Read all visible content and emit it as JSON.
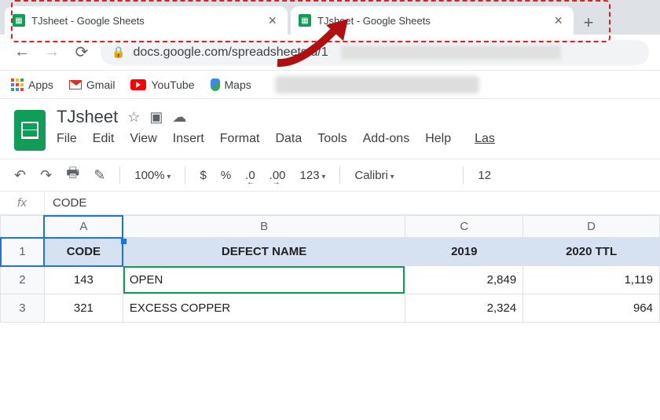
{
  "browser": {
    "tabs": [
      {
        "title": "TJsheet - Google Sheets"
      },
      {
        "title": "TJsheet - Google Sheets"
      }
    ],
    "url": "docs.google.com/spreadsheets/d/1"
  },
  "bookmarks": {
    "apps": "Apps",
    "gmail": "Gmail",
    "youtube": "YouTube",
    "maps": "Maps"
  },
  "doc": {
    "title": "TJsheet",
    "menus": [
      "File",
      "Edit",
      "View",
      "Insert",
      "Format",
      "Data",
      "Tools",
      "Add-ons",
      "Help"
    ],
    "last_edit": "Las"
  },
  "toolbar": {
    "zoom": "100%",
    "currency": "$",
    "percent": "%",
    "dec_dec": ".0",
    "dec_inc": ".00",
    "numfmt": "123",
    "font": "Calibri",
    "fontsize": "12"
  },
  "formula_bar": {
    "label": "fx",
    "value": "CODE"
  },
  "sheet": {
    "columns": [
      "A",
      "B",
      "C",
      "D"
    ],
    "row_labels": [
      "1",
      "2",
      "3"
    ],
    "header": [
      "CODE",
      "DEFECT NAME",
      "2019",
      "2020 TTL"
    ],
    "rows": [
      {
        "code": "143",
        "name": "OPEN",
        "y2019": "2,849",
        "y2020": "1,119"
      },
      {
        "code": "321",
        "name": "EXCESS COPPER",
        "y2019": "2,324",
        "y2020": "964"
      }
    ]
  }
}
